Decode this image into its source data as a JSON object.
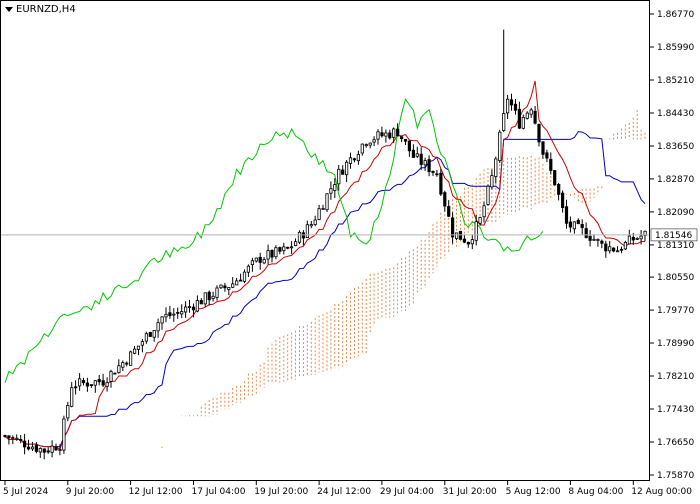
{
  "chart_data": {
    "type": "candlestick",
    "symbol_label": "EURNZD,H4",
    "current_price": "1.81546",
    "y_ticks": [
      "1.86770",
      "1.85990",
      "1.85210",
      "1.84430",
      "1.83650",
      "1.82870",
      "1.82090",
      "1.81310",
      "1.80550",
      "1.79770",
      "1.78990",
      "1.78210",
      "1.77430",
      "1.76650",
      "1.75870"
    ],
    "ylim": [
      1.7587,
      1.8677
    ],
    "x_ticks": [
      "5 Jul 2024",
      "9 Jul 20:00",
      "12 Jul 12:00",
      "17 Jul 04:00",
      "19 Jul 20:00",
      "24 Jul 12:00",
      "29 Jul 04:00",
      "31 Jul 20:00",
      "5 Aug 12:00",
      "8 Aug 04:00",
      "12 Aug 00:00"
    ],
    "x_tick_bar_index": [
      0,
      16,
      32,
      48,
      64,
      80,
      96,
      112,
      128,
      144,
      160
    ],
    "bar_count": 164,
    "price_path": [
      [
        0,
        1.768
      ],
      [
        10,
        1.7645
      ],
      [
        14,
        1.766
      ],
      [
        17,
        1.78
      ],
      [
        25,
        1.781
      ],
      [
        32,
        1.787
      ],
      [
        40,
        1.796
      ],
      [
        44,
        1.797
      ],
      [
        50,
        1.8
      ],
      [
        58,
        1.804
      ],
      [
        65,
        1.81
      ],
      [
        72,
        1.812
      ],
      [
        78,
        1.818
      ],
      [
        85,
        1.83
      ],
      [
        92,
        1.838
      ],
      [
        100,
        1.84
      ],
      [
        104,
        1.834
      ],
      [
        110,
        1.83
      ],
      [
        114,
        1.816
      ],
      [
        118,
        1.814
      ],
      [
        121,
        1.819
      ],
      [
        124,
        1.829
      ],
      [
        128,
        1.848
      ],
      [
        131,
        1.842
      ],
      [
        134,
        1.846
      ],
      [
        137,
        1.835
      ],
      [
        140,
        1.828
      ],
      [
        143,
        1.818
      ],
      [
        148,
        1.816
      ],
      [
        152,
        1.813
      ],
      [
        156,
        1.812
      ],
      [
        160,
        1.8145
      ],
      [
        163,
        1.8155
      ]
    ],
    "special_spike": {
      "bar": 127,
      "high": 1.864
    },
    "series_colors": {
      "candles": "#000000",
      "tenkan": "#d00000",
      "kijun": "#0000c0",
      "chikou": "#00c800",
      "cloud": "#e8894a",
      "grid_line": "#b4b4b4"
    },
    "indicator": "Ichimoku Kinko Hyo (9, 26, 52)"
  }
}
